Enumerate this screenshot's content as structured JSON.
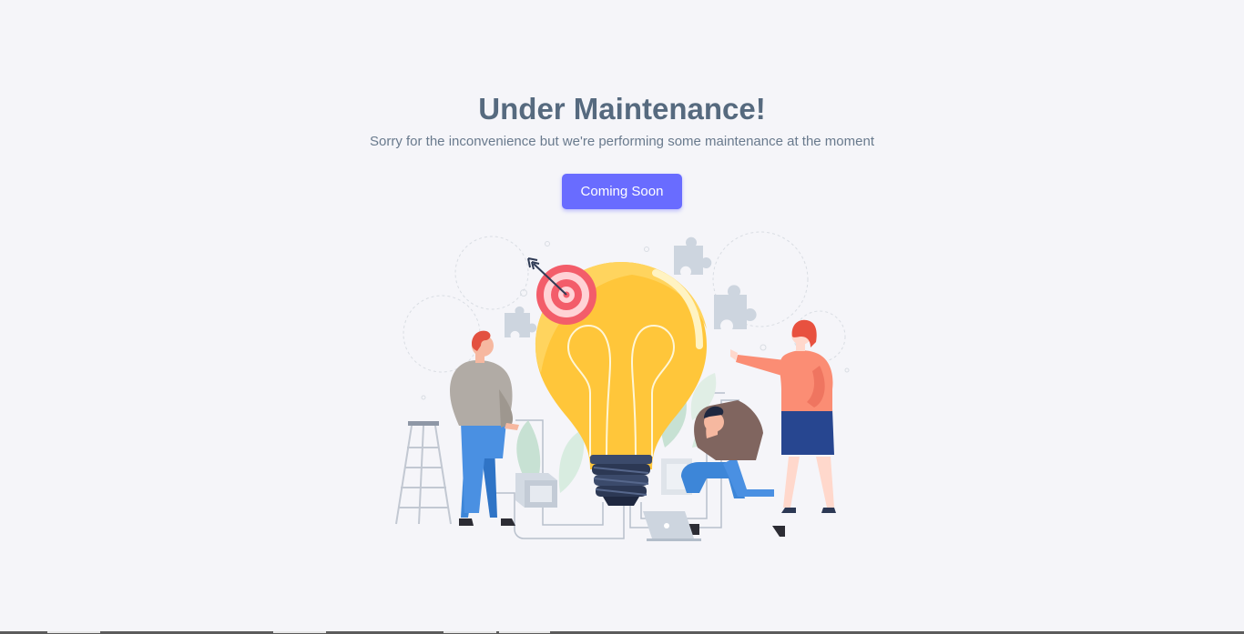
{
  "page": {
    "title": "Under Maintenance!",
    "subtitle": "Sorry for the inconvenience but we're performing some maintenance at the moment",
    "button_label": "Coming Soon"
  },
  "colors": {
    "background": "#f5f5f9",
    "heading": "#566a7f",
    "body_text": "#697a8d",
    "primary": "#696cff"
  },
  "illustration": {
    "name": "maintenance-illustration",
    "icons": [
      "lightbulb-icon",
      "target-icon",
      "arrow-icon",
      "puzzle-icon",
      "ladder-icon",
      "laptop-icon",
      "plant-icon",
      "box-icon"
    ]
  }
}
